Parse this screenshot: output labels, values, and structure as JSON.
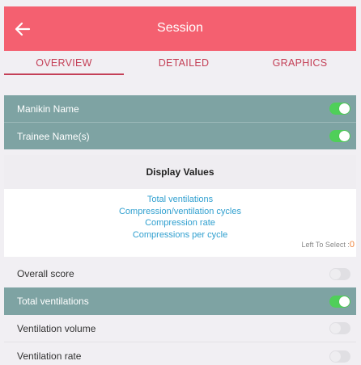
{
  "header": {
    "title": "Session",
    "back_icon": "arrow-left-icon"
  },
  "tabs": [
    {
      "label": "OVERVIEW",
      "active": true
    },
    {
      "label": "DETAILED",
      "active": false
    },
    {
      "label": "GRAPHICS",
      "active": false
    }
  ],
  "settings": {
    "manikin_name": {
      "label": "Manikin Name",
      "on": true
    },
    "trainee_names": {
      "label": "Trainee Name(s)",
      "on": true
    }
  },
  "display_values": {
    "title": "Display Values",
    "selected": [
      "Total ventilations",
      "Compression/ventilation cycles",
      "Compression rate",
      "Compressions per cycle"
    ],
    "left_to_select_label": "Left To Select :",
    "left_to_select_count": "0"
  },
  "options": [
    {
      "label": "Overall score",
      "on": false
    },
    {
      "label": "Total ventilations",
      "on": true
    },
    {
      "label": "Ventilation volume",
      "on": false
    },
    {
      "label": "Ventilation rate",
      "on": false
    }
  ],
  "colors": {
    "header": "#f46070",
    "accent": "#c44057",
    "teal_row": "#7ea3a3",
    "toggle_on": "#4fcf59",
    "value_text": "#2f9fcf",
    "counter": "#f0833a"
  }
}
